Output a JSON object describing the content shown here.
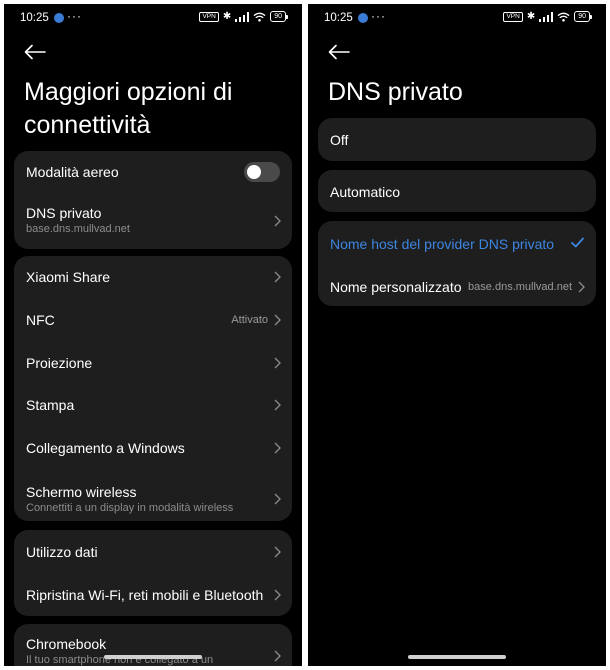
{
  "status_bar": {
    "time": "10:25",
    "more": "···",
    "vpn": "VPN",
    "battery": "90",
    "bluetooth_icon": "bluetooth-icon",
    "signal_icon": "signal-icon",
    "wifi_icon": "wifi-icon"
  },
  "left_screen": {
    "title": "Maggiori opzioni di connettività",
    "airplane": {
      "label": "Modalità aereo",
      "enabled": false
    },
    "dns": {
      "label": "DNS privato",
      "value": "base.dns.mullvad.net"
    },
    "items": [
      {
        "label": "Xiaomi Share"
      },
      {
        "label": "NFC",
        "value": "Attivato"
      },
      {
        "label": "Proiezione"
      },
      {
        "label": "Stampa"
      },
      {
        "label": "Collegamento a Windows"
      },
      {
        "label": "Schermo wireless",
        "sub": "Connettiti a un display in modalità wireless"
      }
    ],
    "data_items": [
      {
        "label": "Utilizzo dati"
      },
      {
        "label": "Ripristina Wi-Fi, reti mobili e Bluetooth"
      }
    ],
    "chromebook": {
      "label": "Chromebook",
      "sub": "Il tuo smartphone non è collegato a un"
    }
  },
  "right_screen": {
    "title": "DNS privato",
    "options": {
      "off": "Off",
      "auto": "Automatico",
      "hostname": "Nome host del provider DNS privato",
      "custom": "Nome personalizzato",
      "custom_value": "base.dns.mullvad.net"
    },
    "selected": "hostname"
  },
  "colors": {
    "background": "#000000",
    "card": "#1e1e1e",
    "accent": "#3d86e0",
    "secondary_text": "#8c8c8c"
  }
}
